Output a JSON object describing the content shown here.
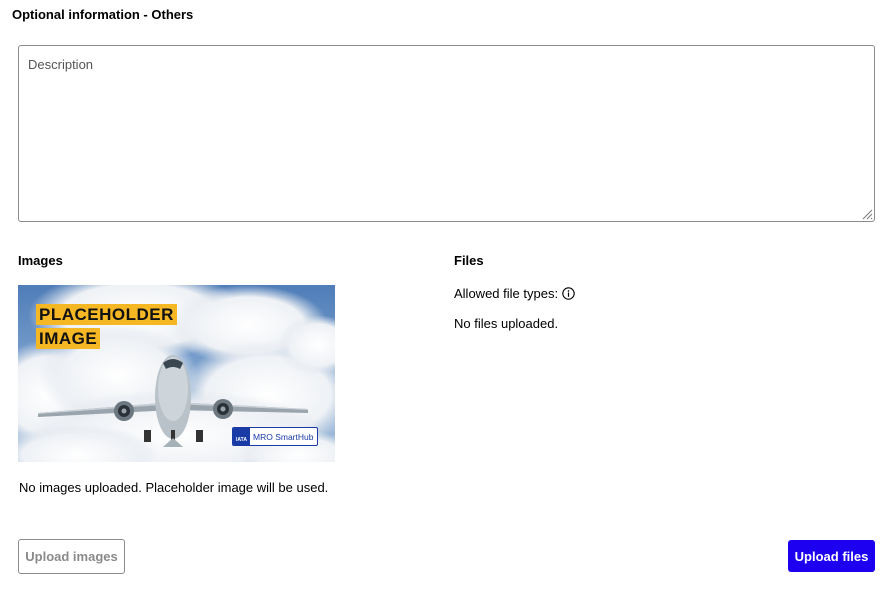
{
  "section": {
    "title": "Optional information - Others"
  },
  "description": {
    "placeholder": "Description",
    "value": ""
  },
  "images": {
    "heading": "Images",
    "placeholder_line1": "PLACEHOLDER",
    "placeholder_line2": "IMAGE",
    "logo_badge_text": "IATA",
    "logo_text": "MRO SmartHub",
    "status_text": "No images uploaded. Placeholder image will be used.",
    "upload_button_label": "Upload images"
  },
  "files": {
    "heading": "Files",
    "allowed_types_label": "Allowed file types:",
    "info_icon": "info-icon",
    "status_text": "No files uploaded.",
    "upload_button_label": "Upload files"
  },
  "colors": {
    "primary_button": "#1d00f0",
    "placeholder_label_bg": "#f5b724",
    "logo_blue": "#1a3aa6"
  }
}
